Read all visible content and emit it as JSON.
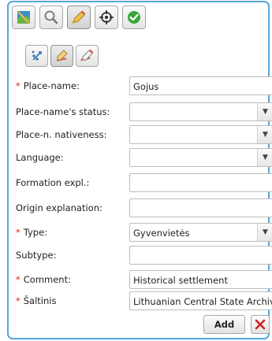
{
  "toolbar": {
    "main": [
      {
        "icon": "map-icon",
        "active": false
      },
      {
        "icon": "zoom-icon",
        "active": false
      },
      {
        "icon": "edit-pencil-icon",
        "active": true
      },
      {
        "icon": "crosshair-icon",
        "active": false
      },
      {
        "icon": "confirm-check-icon",
        "active": false
      }
    ],
    "edit": [
      {
        "icon": "move-points-icon",
        "active": false
      },
      {
        "icon": "draw-pencil-icon",
        "active": true
      },
      {
        "icon": "erase-pencil-icon",
        "active": false
      }
    ]
  },
  "form": {
    "place_name": {
      "label": "Place-name:",
      "required": true,
      "value": "Gojus"
    },
    "status": {
      "label": "Place-name's status:",
      "required": false,
      "value": ""
    },
    "nativeness": {
      "label": "Place-n. nativeness:",
      "required": false,
      "value": ""
    },
    "language": {
      "label": "Language:",
      "required": false,
      "value": ""
    },
    "formation": {
      "label": "Formation expl.:",
      "required": false,
      "value": ""
    },
    "origin": {
      "label": "Origin explanation:",
      "required": false,
      "value": ""
    },
    "type": {
      "label": "Type:",
      "required": true,
      "value": "Gyvenvietės"
    },
    "subtype": {
      "label": "Subtype:",
      "required": false,
      "value": ""
    },
    "comment": {
      "label": "Comment:",
      "required": true,
      "value": "Historical settlement"
    },
    "source": {
      "label": "Šaltinis",
      "required": true,
      "value": "Lithuanian Central State Archives"
    }
  },
  "required_marker": "*",
  "actions": {
    "add_label": "Add",
    "cancel_icon": "close-x-icon"
  },
  "colors": {
    "border": "#55a7dc",
    "required": "#d81e1e",
    "cancel": "#d32020"
  }
}
